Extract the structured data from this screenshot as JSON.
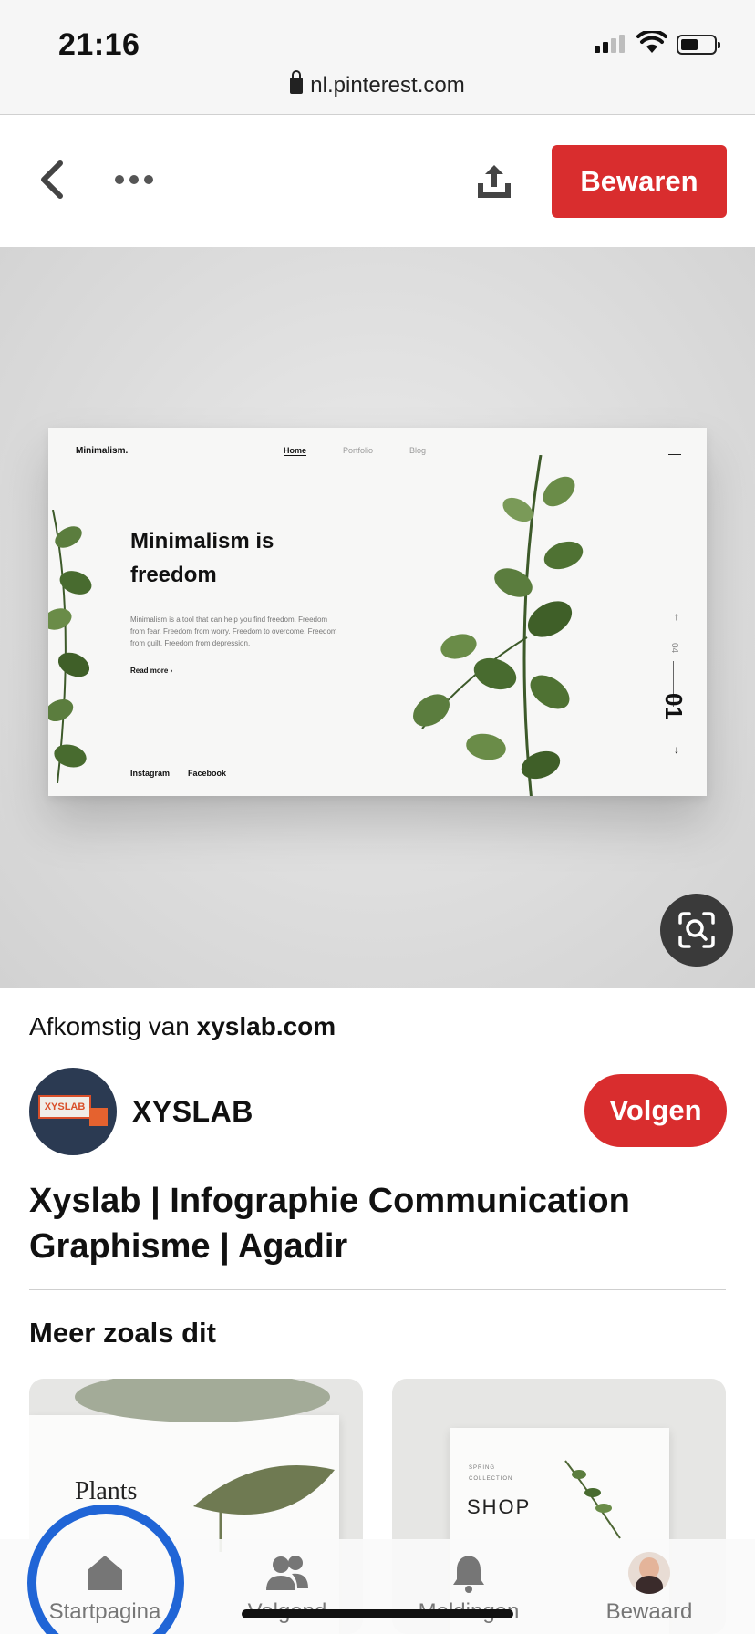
{
  "status_bar": {
    "time": "21:16",
    "url": "nl.pinterest.com",
    "icons": [
      "signal-icon",
      "wifi-icon",
      "battery-icon",
      "lock-icon"
    ]
  },
  "top_bar": {
    "back_icon": "chevron-left-icon",
    "more_icon": "ellipsis-icon",
    "share_icon": "share-upload-icon",
    "save_label": "Bewaren"
  },
  "pin": {
    "mockup": {
      "brand": "Minimalism.",
      "nav": [
        "Home",
        "Portfolio",
        "Blog"
      ],
      "headline": "Minimalism is freedom",
      "body": "Minimalism is a tool that can help you find freedom. Freedom from fear. Freedom from worry. Freedom to overcome. Freedom from guilt. Freedom from depression.",
      "read_more": "Read more",
      "links": [
        "Instagram",
        "Facebook"
      ],
      "slide_current": "01",
      "slide_total": "04"
    },
    "lens_icon": "visual-search-icon",
    "source_prefix": "Afkomstig van",
    "source_domain": "xyslab.com",
    "title": "Xyslab | Infographie Communication Graphisme | Agadir"
  },
  "creator": {
    "name": "XYSLAB",
    "avatar_text": "XYSLAB",
    "follow_label": "Volgen"
  },
  "more_like_this": {
    "heading": "Meer zoals dit",
    "cards": [
      {
        "word": "Plants"
      },
      {
        "word": "SHOP",
        "small_lines": [
          "SPRING",
          "COLLECTION"
        ]
      }
    ]
  },
  "tab_bar": {
    "tabs": [
      {
        "label": "Startpagina",
        "icon": "home-icon",
        "active": true
      },
      {
        "label": "Volgend",
        "icon": "people-icon"
      },
      {
        "label": "Meldingen",
        "icon": "bell-icon"
      },
      {
        "label": "Bewaard",
        "icon": "profile-avatar"
      }
    ],
    "highlight_color": "#2065d6"
  },
  "colors": {
    "accent": "#d92d2e",
    "text": "#111111",
    "tab_inactive": "#767676"
  }
}
